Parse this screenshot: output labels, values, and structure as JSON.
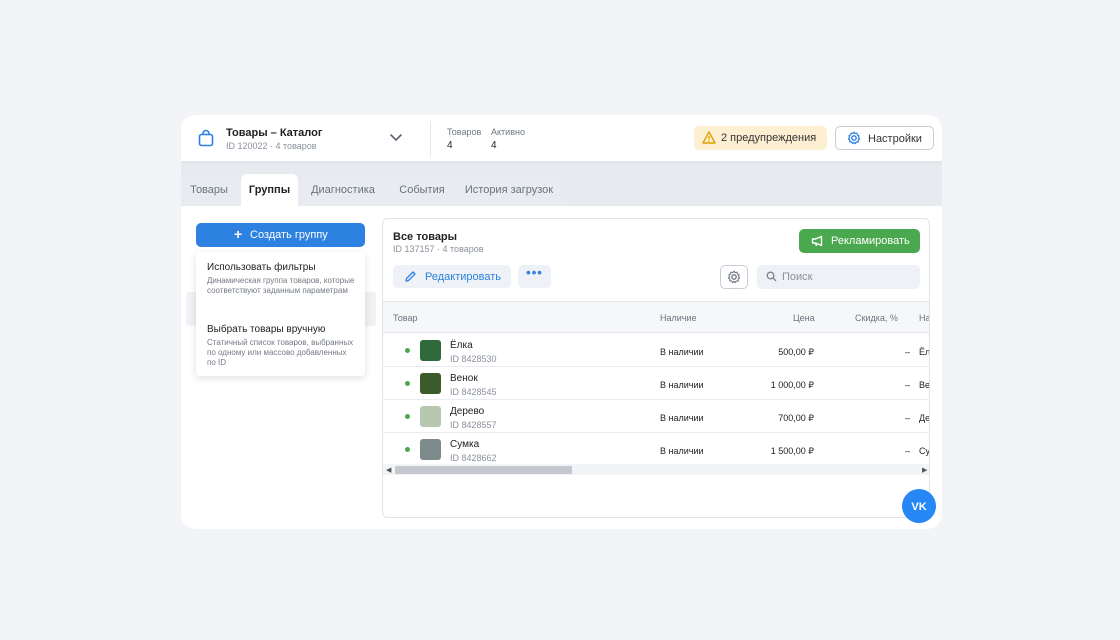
{
  "header": {
    "catalog_title": "Товары – Каталог",
    "catalog_subtitle": "ID 120022 · 4 товаров",
    "stats": [
      {
        "label": "Товаров",
        "value": "4"
      },
      {
        "label": "Активно",
        "value": "4"
      }
    ],
    "warning_label": "2 предупреждения",
    "settings_label": "Настройки"
  },
  "tabs": [
    {
      "label": "Товары",
      "active": false
    },
    {
      "label": "Группы",
      "active": true
    },
    {
      "label": "Диагностика",
      "active": false
    },
    {
      "label": "События",
      "active": false
    },
    {
      "label": "История загрузок",
      "active": false
    }
  ],
  "left": {
    "create_group_label": "Создать группу",
    "dropdown": [
      {
        "title": "Использовать фильтры",
        "description": "Динамическая группа товаров, которые соответствуют заданным параметрам"
      },
      {
        "title": "Выбрать товары вручную",
        "description": "Статичный список товаров, выбранных по одному или массово добавленных по ID"
      }
    ]
  },
  "panel": {
    "title": "Все товары",
    "subtitle": "ID 137157 · 4 товаров",
    "promote_label": "Рекламировать",
    "edit_label": "Редактировать",
    "more_label": "•••",
    "search_placeholder": "Поиск",
    "columns": [
      "Товар",
      "Наличие",
      "Цена",
      "Скидка, %",
      "На"
    ],
    "rows": [
      {
        "name": "Ёлка",
        "id": "ID 8428530",
        "availability": "В наличии",
        "price": "500,00 ₽",
        "discount": "–",
        "extra": "Ёл",
        "thumb_color": "#2f6b3a"
      },
      {
        "name": "Венок",
        "id": "ID 8428545",
        "availability": "В наличии",
        "price": "1 000,00 ₽",
        "discount": "–",
        "extra": "Ве",
        "thumb_color": "#3c5a2a"
      },
      {
        "name": "Дерево",
        "id": "ID 8428557",
        "availability": "В наличии",
        "price": "700,00 ₽",
        "discount": "–",
        "extra": "Де",
        "thumb_color": "#b8c7b0"
      },
      {
        "name": "Сумка",
        "id": "ID 8428662",
        "availability": "В наличии",
        "price": "1 500,00 ₽",
        "discount": "–",
        "extra": "Су",
        "thumb_color": "#7d8a8c"
      }
    ]
  },
  "colors": {
    "accent": "#2d81e0",
    "promote": "#4aa84e",
    "warning_bg": "#fdf0d2",
    "status_ok": "#4aa84e",
    "vk": "#2787f5"
  },
  "icons": [
    "bag-icon",
    "chevron-down-icon",
    "warning-icon",
    "gear-icon",
    "plus-icon",
    "megaphone-icon",
    "pencil-icon",
    "search-icon",
    "vk-logo-icon"
  ]
}
